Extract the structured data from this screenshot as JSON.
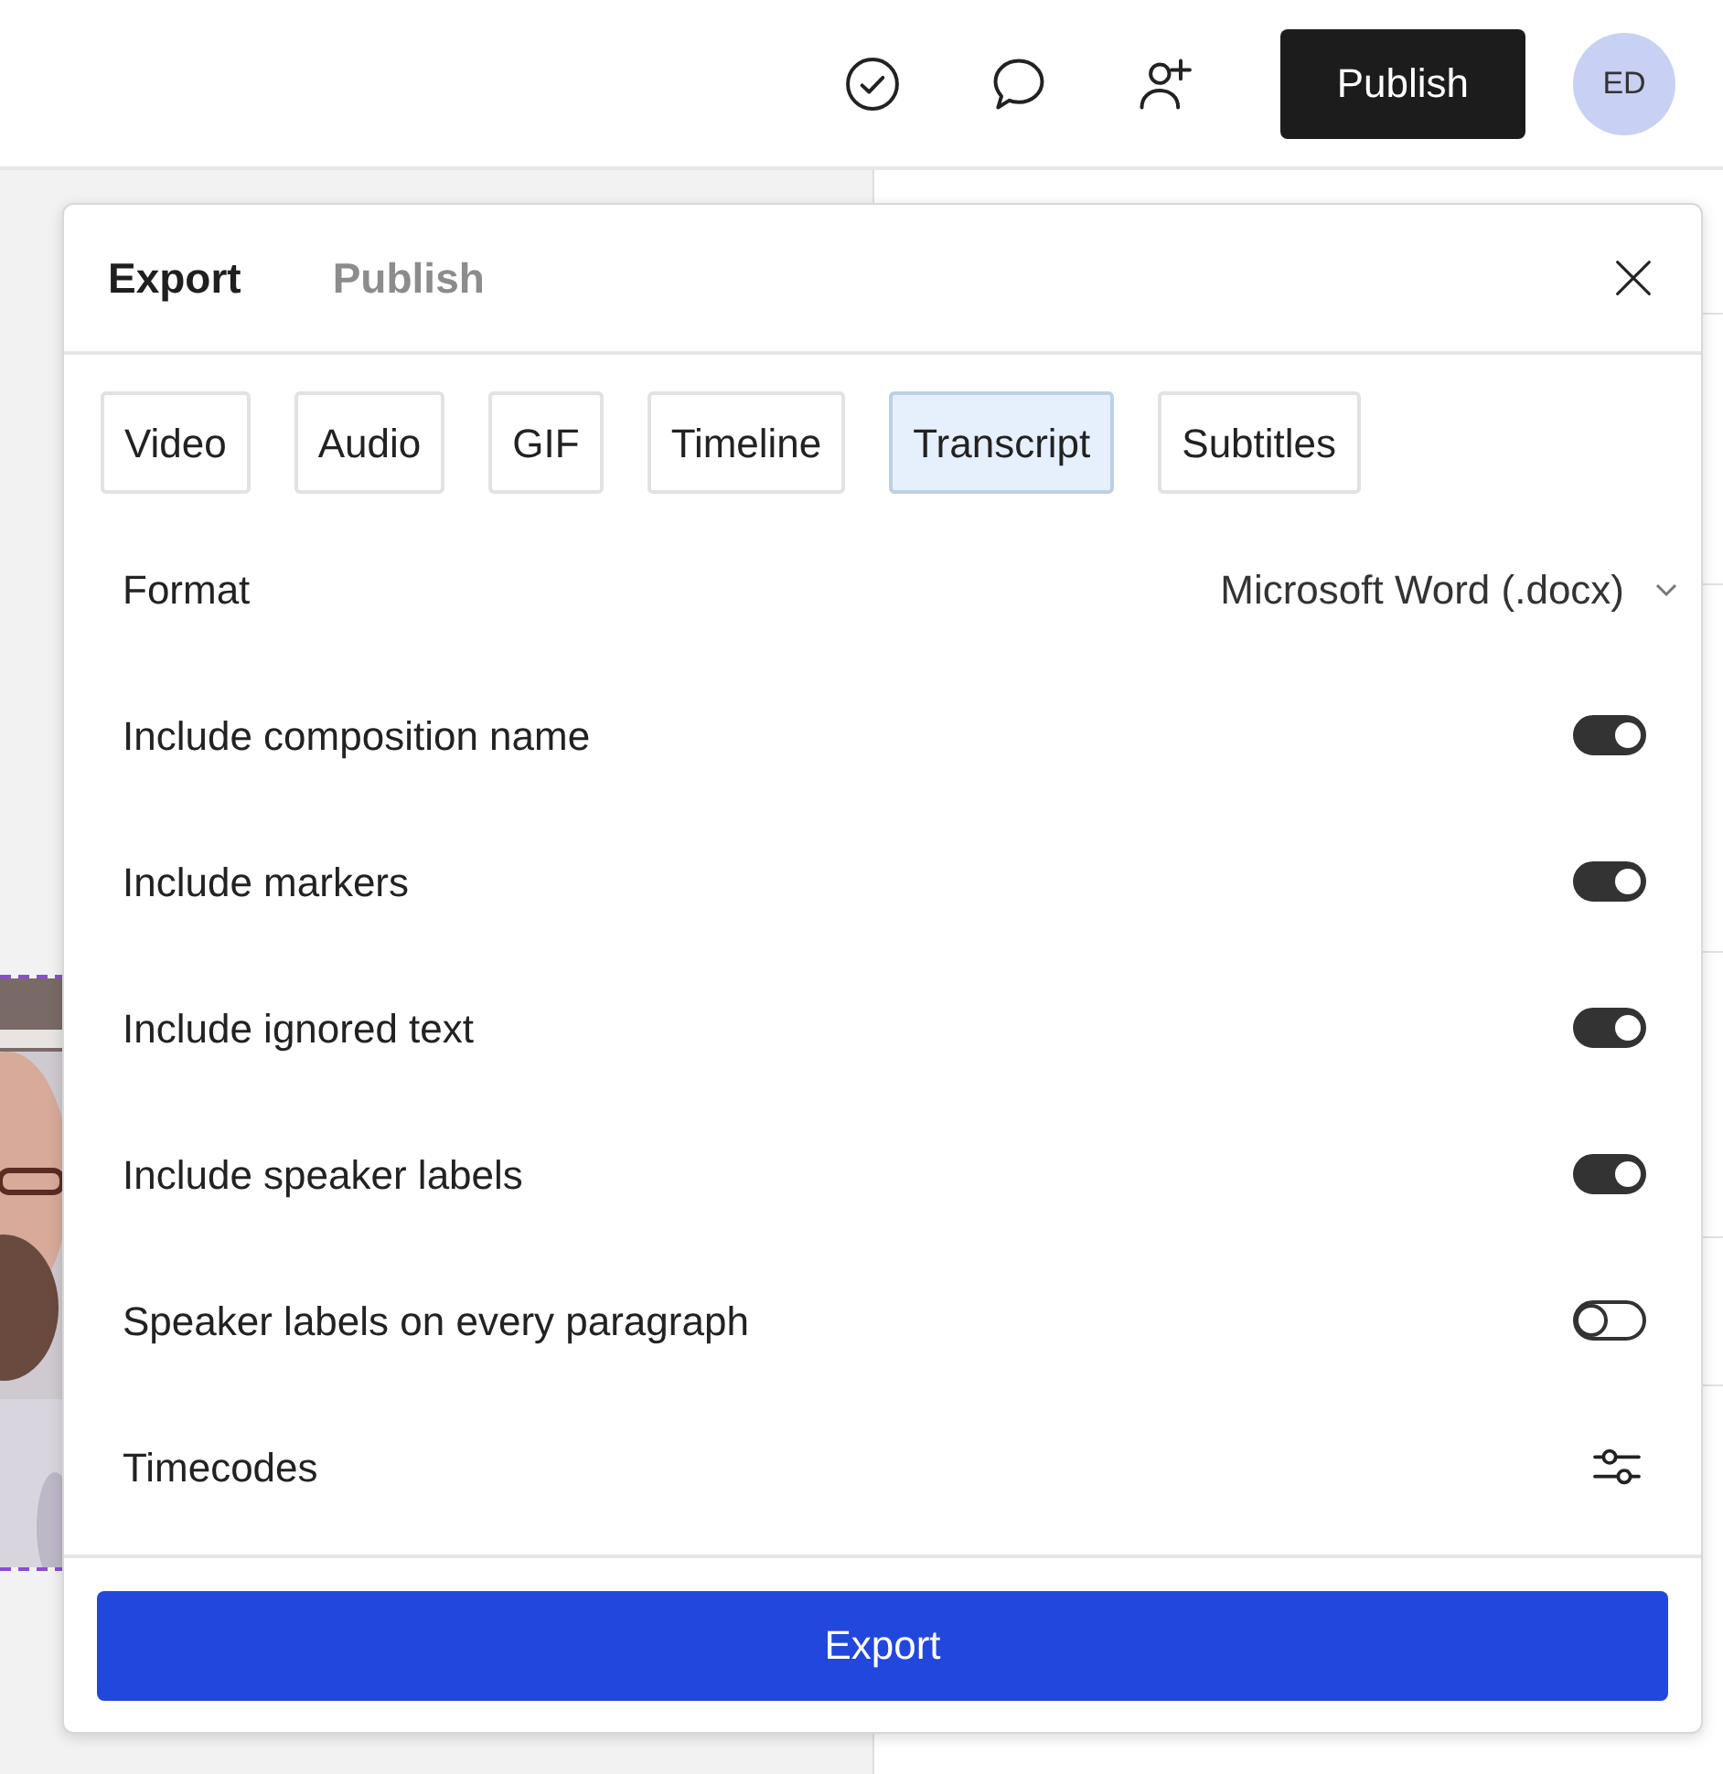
{
  "topbar": {
    "publish_button": "Publish",
    "avatar": "ED"
  },
  "dialog": {
    "tabs": [
      {
        "label": "Export",
        "selected": true
      },
      {
        "label": "Publish",
        "selected": false
      }
    ],
    "formats": [
      {
        "label": "Video",
        "selected": false
      },
      {
        "label": "Audio",
        "selected": false
      },
      {
        "label": "GIF",
        "selected": false
      },
      {
        "label": "Timeline",
        "selected": false
      },
      {
        "label": "Transcript",
        "selected": true
      },
      {
        "label": "Subtitles",
        "selected": false
      }
    ],
    "settings": [
      {
        "kind": "select",
        "label": "Format",
        "value": "Microsoft Word (.docx)"
      },
      {
        "kind": "toggle",
        "label": "Include composition name",
        "on": true
      },
      {
        "kind": "toggle",
        "label": "Include markers",
        "on": true
      },
      {
        "kind": "toggle",
        "label": "Include ignored text",
        "on": true
      },
      {
        "kind": "toggle",
        "label": "Include speaker labels",
        "on": true
      },
      {
        "kind": "toggle",
        "label": "Speaker labels on every paragraph",
        "on": false
      },
      {
        "kind": "options",
        "label": "Timecodes"
      }
    ],
    "export_button": "Export"
  }
}
